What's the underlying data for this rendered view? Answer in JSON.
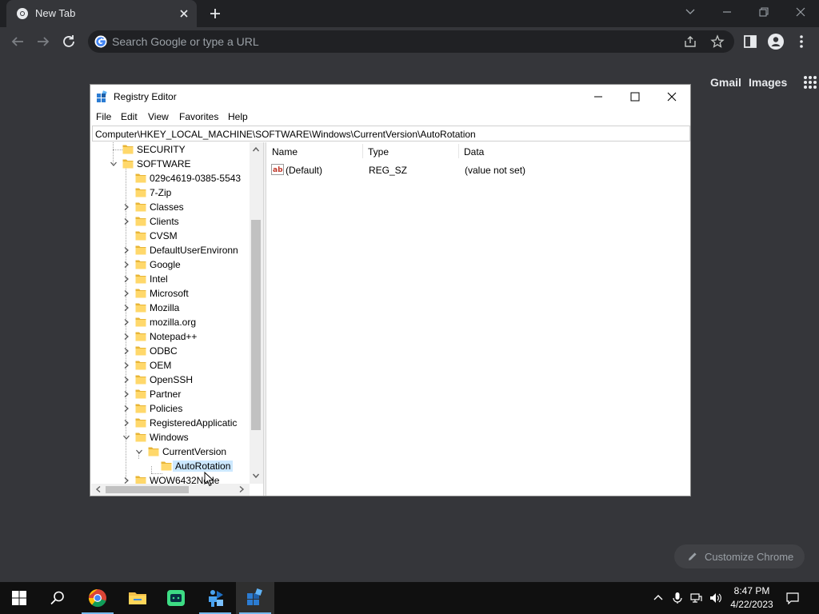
{
  "browser": {
    "tab_title": "New Tab",
    "omnibox_placeholder": "Search Google or type a URL",
    "ntp_links": {
      "gmail": "Gmail",
      "images": "Images"
    },
    "customize_label": "Customize Chrome"
  },
  "regedit": {
    "title": "Registry Editor",
    "menu": [
      "File",
      "Edit",
      "View",
      "Favorites",
      "Help"
    ],
    "address": "Computer\\HKEY_LOCAL_MACHINE\\SOFTWARE\\Windows\\CurrentVersion\\AutoRotation",
    "tree": [
      {
        "label": "SECURITY",
        "level": 1,
        "expander": "none"
      },
      {
        "label": "SOFTWARE",
        "level": 1,
        "expander": "expanded"
      },
      {
        "label": "029c4619-0385-5543",
        "level": 2,
        "expander": "none"
      },
      {
        "label": "7-Zip",
        "level": 2,
        "expander": "none"
      },
      {
        "label": "Classes",
        "level": 2,
        "expander": "collapsed"
      },
      {
        "label": "Clients",
        "level": 2,
        "expander": "collapsed"
      },
      {
        "label": "CVSM",
        "level": 2,
        "expander": "none"
      },
      {
        "label": "DefaultUserEnvironn",
        "level": 2,
        "expander": "collapsed"
      },
      {
        "label": "Google",
        "level": 2,
        "expander": "collapsed"
      },
      {
        "label": "Intel",
        "level": 2,
        "expander": "collapsed"
      },
      {
        "label": "Microsoft",
        "level": 2,
        "expander": "collapsed"
      },
      {
        "label": "Mozilla",
        "level": 2,
        "expander": "collapsed"
      },
      {
        "label": "mozilla.org",
        "level": 2,
        "expander": "collapsed"
      },
      {
        "label": "Notepad++",
        "level": 2,
        "expander": "collapsed"
      },
      {
        "label": "ODBC",
        "level": 2,
        "expander": "collapsed"
      },
      {
        "label": "OEM",
        "level": 2,
        "expander": "collapsed"
      },
      {
        "label": "OpenSSH",
        "level": 2,
        "expander": "collapsed"
      },
      {
        "label": "Partner",
        "level": 2,
        "expander": "collapsed"
      },
      {
        "label": "Policies",
        "level": 2,
        "expander": "collapsed"
      },
      {
        "label": "RegisteredApplicatic",
        "level": 2,
        "expander": "collapsed"
      },
      {
        "label": "Windows",
        "level": 2,
        "expander": "expanded"
      },
      {
        "label": "CurrentVersion",
        "level": 3,
        "expander": "expanded"
      },
      {
        "label": "AutoRotation",
        "level": 4,
        "expander": "none",
        "selected": true
      },
      {
        "label": "WOW6432Node",
        "level": 2,
        "expander": "collapsed"
      }
    ],
    "columns": [
      "Name",
      "Type",
      "Data"
    ],
    "values": [
      {
        "name": "(Default)",
        "type": "REG_SZ",
        "data": "(value not set)"
      }
    ]
  },
  "taskbar": {
    "apps": [
      "start",
      "search",
      "chrome",
      "file-explorer",
      "android-studio",
      "remote-desktop",
      "registry-editor"
    ],
    "active_app": "registry-editor",
    "clock": {
      "time": "8:47 PM",
      "date": "4/22/2023"
    }
  },
  "colors": {
    "chrome_frame": "#202124",
    "chrome_toolbar": "#35363a",
    "selection": "#cce8ff",
    "folder": "#e8b536",
    "taskbar": "#101010",
    "taskbar_accent": "#76b9ed"
  }
}
